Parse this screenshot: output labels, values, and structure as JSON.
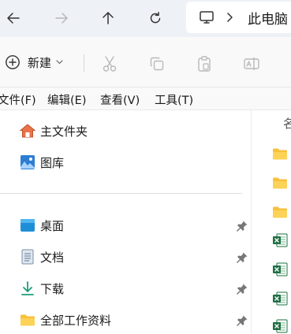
{
  "address": {
    "crumb": "此电脑"
  },
  "toolbar": {
    "new_label": "新建"
  },
  "menu": [
    {
      "label": "文件(F)"
    },
    {
      "label": "编辑(E)"
    },
    {
      "label": "查看(V)"
    },
    {
      "label": "工具(T)"
    }
  ],
  "sidebar": {
    "top_items": [
      {
        "label": "主文件夹",
        "icon": "home-icon"
      },
      {
        "label": "图库",
        "icon": "gallery-icon"
      }
    ],
    "pinned_items": [
      {
        "label": "桌面",
        "icon": "desktop-icon"
      },
      {
        "label": "文档",
        "icon": "document-icon"
      },
      {
        "label": "下载",
        "icon": "download-icon"
      },
      {
        "label": "全部工作资料",
        "icon": "folder-icon"
      }
    ]
  },
  "content": {
    "column_header": "名",
    "file_icons": [
      "folder-icon",
      "folder-icon",
      "folder-icon",
      "excel-icon",
      "excel-icon",
      "excel-icon",
      "excel-icon"
    ]
  },
  "colors": {
    "accent": "#0067c0",
    "folder": "#f8c13c",
    "excel": "#1d6f42"
  }
}
